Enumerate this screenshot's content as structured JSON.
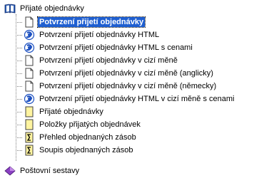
{
  "tree": {
    "root": {
      "label": "Přijaté objednávky",
      "icon": "book-icon"
    },
    "children": [
      {
        "label": "Potvrzení přijetí objednávky",
        "icon": "document-icon",
        "selected": true
      },
      {
        "label": "Potvrzení přijetí objednávky HTML",
        "icon": "browser-icon"
      },
      {
        "label": "Potvrzení přijetí objednávky HTML s cenami",
        "icon": "browser-icon"
      },
      {
        "label": "Potvrzení přijetí objednávky v cizí měně",
        "icon": "document-icon"
      },
      {
        "label": "Potvrzení přijetí objednávky v cizí měně (anglicky)",
        "icon": "document-icon"
      },
      {
        "label": "Potvrzení přijetí objednávky v cizí měně (německy)",
        "icon": "document-icon"
      },
      {
        "label": "Potvrzení přijetí objednávky HTML v cizí měně s cenami",
        "icon": "browser-icon"
      },
      {
        "label": "Přijaté objednávky",
        "icon": "yellow-document-icon"
      },
      {
        "label": "Položky přijatých objednávek",
        "icon": "yellow-document-icon"
      },
      {
        "label": "Přehled objednaných zásob",
        "icon": "sum-document-icon"
      },
      {
        "label": "Soupis objednaných zásob",
        "icon": "sum-document-icon"
      }
    ],
    "next_root": {
      "label": "Poštovní sestavy",
      "icon": "diamond-folder-icon"
    }
  },
  "colors": {
    "selection": "#1f5fd1",
    "book": "#2b5fb5",
    "browser": "#1b4fc0",
    "yellow_doc": "#fff4a0",
    "diamond": "#8a3fc2"
  }
}
